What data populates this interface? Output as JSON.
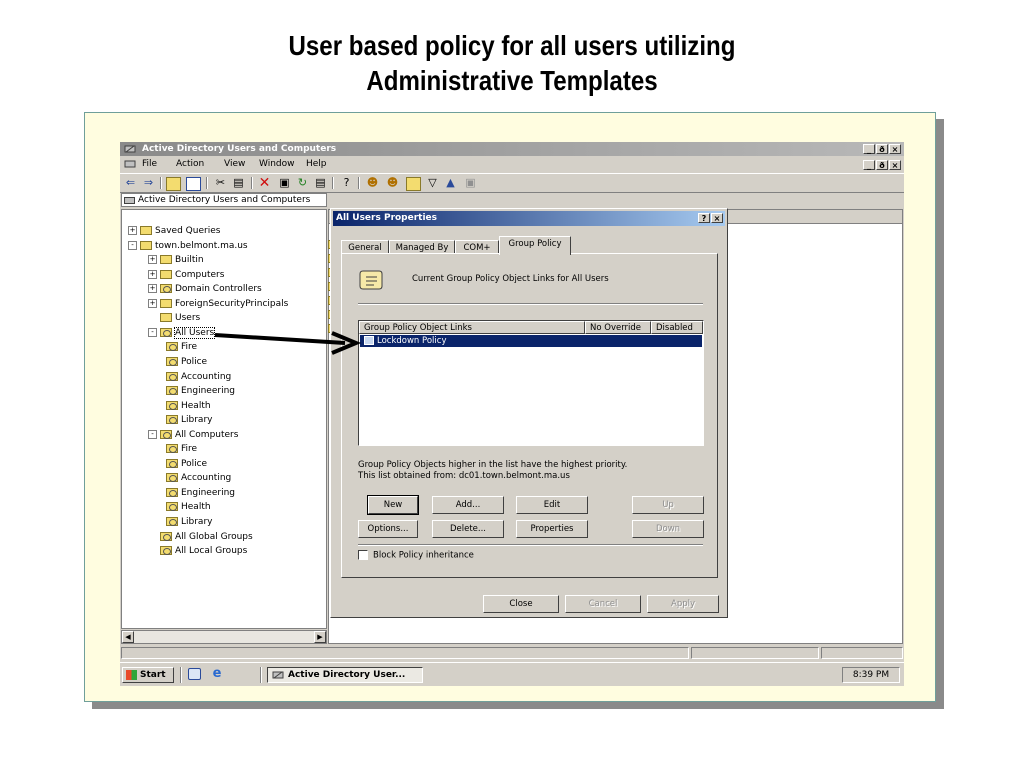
{
  "slide": {
    "title_line1": "User based policy for all users utilizing",
    "title_line2": "Administrative Templates"
  },
  "window": {
    "title": "Active Directory Users and Computers",
    "menu": [
      "File",
      "Action",
      "View",
      "Window",
      "Help"
    ],
    "minimize": "_",
    "restore": "ð",
    "close": "×"
  },
  "toolbar": {
    "icons": [
      "back-arrow-icon",
      "forward-arrow-icon",
      "up-folder-icon",
      "show-pane-icon",
      "cut-icon",
      "paste-icon",
      "delete-icon",
      "properties-icon",
      "refresh-icon",
      "export-icon",
      "help-icon",
      "new-user-icon",
      "new-group-icon",
      "new-ou-icon",
      "filter-icon",
      "add-to-group-icon",
      "find-icon"
    ]
  },
  "tree": {
    "root": "Active Directory Users and Computers",
    "items": [
      {
        "label": "Saved Queries",
        "level": 1,
        "expander": "+"
      },
      {
        "label": "town.belmont.ma.us",
        "level": 1,
        "expander": "-"
      },
      {
        "label": "Builtin",
        "level": 2,
        "expander": "+"
      },
      {
        "label": "Computers",
        "level": 2,
        "expander": "+"
      },
      {
        "label": "Domain Controllers",
        "level": 2,
        "expander": "+"
      },
      {
        "label": "ForeignSecurityPrincipals",
        "level": 2,
        "expander": "+"
      },
      {
        "label": "Users",
        "level": 2,
        "expander": ""
      },
      {
        "label": "All Users",
        "level": 2,
        "expander": "-"
      },
      {
        "label": "Fire",
        "level": 3,
        "expander": ""
      },
      {
        "label": "Police",
        "level": 3,
        "expander": ""
      },
      {
        "label": "Accounting",
        "level": 3,
        "expander": ""
      },
      {
        "label": "Engineering",
        "level": 3,
        "expander": ""
      },
      {
        "label": "Health",
        "level": 3,
        "expander": ""
      },
      {
        "label": "Library",
        "level": 3,
        "expander": ""
      },
      {
        "label": "All Computers",
        "level": 2,
        "expander": "-"
      },
      {
        "label": "Fire",
        "level": 3,
        "expander": ""
      },
      {
        "label": "Police",
        "level": 3,
        "expander": ""
      },
      {
        "label": "Accounting",
        "level": 3,
        "expander": ""
      },
      {
        "label": "Engineering",
        "level": 3,
        "expander": ""
      },
      {
        "label": "Health",
        "level": 3,
        "expander": ""
      },
      {
        "label": "Library",
        "level": 3,
        "expander": ""
      },
      {
        "label": "All Global Groups",
        "level": 2,
        "expander": ""
      },
      {
        "label": "All Local Groups",
        "level": 2,
        "expander": ""
      }
    ]
  },
  "dialog": {
    "title": "All Users Properties",
    "help_btn": "?",
    "close_btn": "×",
    "tabs": [
      "General",
      "Managed By",
      "COM+",
      "Group Policy"
    ],
    "active_tab": "Group Policy",
    "heading": "Current Group Policy Object Links for All Users",
    "columns": [
      "Group Policy Object Links",
      "No Override",
      "Disabled"
    ],
    "rows": [
      {
        "name": "Lockdown Policy",
        "no_override": "",
        "disabled": ""
      }
    ],
    "note_line1": "Group Policy Objects higher in the list have the highest priority.",
    "note_line2": "This list obtained from: dc01.town.belmont.ma.us",
    "buttons": {
      "new": "New",
      "add": "Add...",
      "edit": "Edit",
      "up": "Up",
      "options": "Options...",
      "delete": "Delete...",
      "properties": "Properties",
      "down": "Down"
    },
    "block_inheritance": "Block Policy inheritance",
    "footer": {
      "close": "Close",
      "cancel": "Cancel",
      "apply": "Apply"
    }
  },
  "taskbar": {
    "start": "Start",
    "quicklaunch": [
      "show-desktop-icon",
      "internet-explorer-icon"
    ],
    "task": "Active Directory User...",
    "clock": "8:39 PM"
  }
}
